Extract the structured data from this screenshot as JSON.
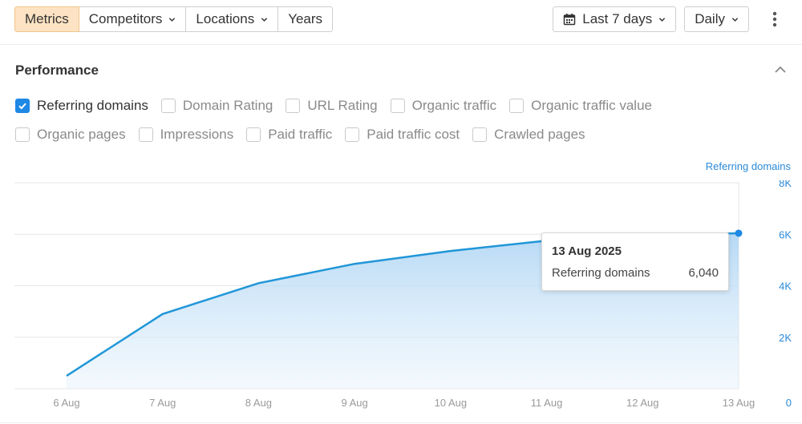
{
  "toolbar": {
    "tabs": [
      {
        "label": "Metrics",
        "active": true,
        "has_dropdown": false
      },
      {
        "label": "Competitors",
        "active": false,
        "has_dropdown": true
      },
      {
        "label": "Locations",
        "active": false,
        "has_dropdown": true
      },
      {
        "label": "Years",
        "active": false,
        "has_dropdown": false
      }
    ],
    "date_range_label": "Last 7 days",
    "interval_label": "Daily"
  },
  "section": {
    "title": "Performance"
  },
  "metrics": {
    "row1": [
      {
        "label": "Referring domains",
        "checked": true
      },
      {
        "label": "Domain Rating",
        "checked": false
      },
      {
        "label": "URL Rating",
        "checked": false
      },
      {
        "label": "Organic traffic",
        "checked": false
      },
      {
        "label": "Organic traffic value",
        "checked": false
      }
    ],
    "row2": [
      {
        "label": "Organic pages",
        "checked": false
      },
      {
        "label": "Impressions",
        "checked": false
      },
      {
        "label": "Paid traffic",
        "checked": false
      },
      {
        "label": "Paid traffic cost",
        "checked": false
      },
      {
        "label": "Crawled pages",
        "checked": false
      }
    ]
  },
  "colors": {
    "accent": "#1e88e5",
    "line": "#2196d8",
    "active_tab_bg": "#fde3c3",
    "axis_text": "#2b8ad8"
  },
  "tooltip": {
    "date": "13 Aug 2025",
    "series_name": "Referring domains",
    "value": "6,040"
  },
  "chart_data": {
    "type": "area",
    "series_label": "Referring domains",
    "x": [
      "6 Aug",
      "7 Aug",
      "8 Aug",
      "9 Aug",
      "10 Aug",
      "11 Aug",
      "12 Aug",
      "13 Aug"
    ],
    "series": [
      {
        "name": "Referring domains",
        "values": [
          500,
          2900,
          4100,
          4850,
          5350,
          5750,
          5950,
          6040
        ]
      }
    ],
    "y_ticks": [
      "0",
      "2K",
      "4K",
      "6K",
      "8K"
    ],
    "ylim": [
      0,
      8000
    ],
    "y_axis_side": "right",
    "grid": true,
    "highlighted_point": 7
  }
}
